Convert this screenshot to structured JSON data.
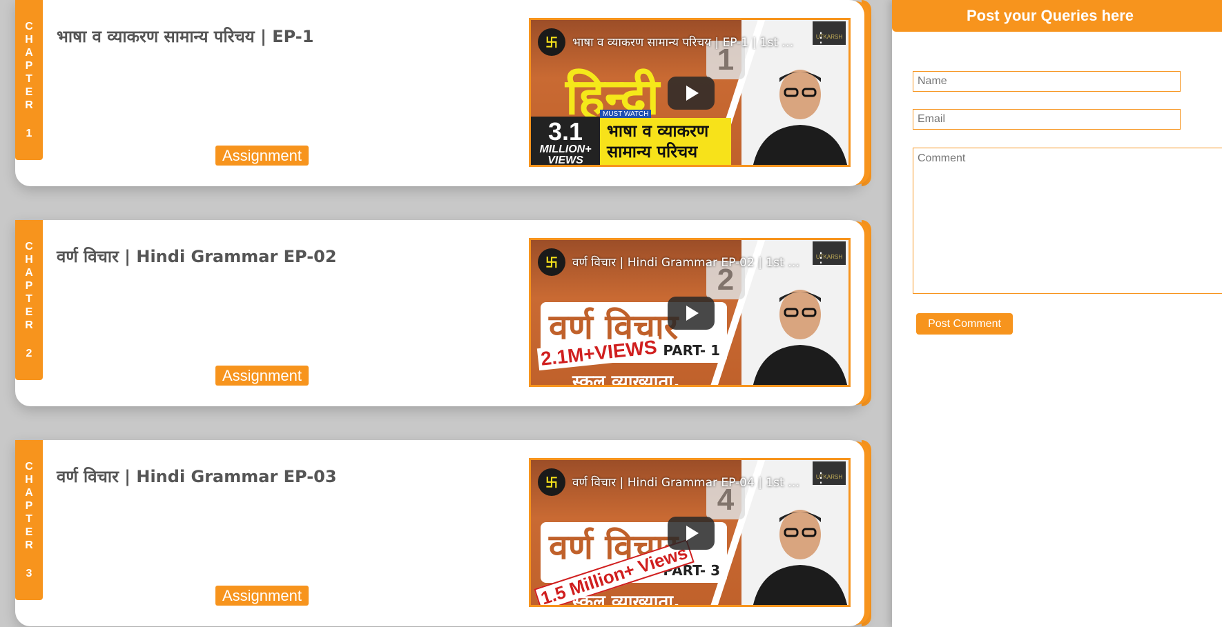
{
  "chapters": [
    {
      "tab_word": [
        "C",
        "H",
        "A",
        "P",
        "T",
        "E",
        "R"
      ],
      "number": "1",
      "title": "भाषा व व्याकरण सामान्य परिचय | EP-1",
      "assignment_label": "Assignment",
      "video": {
        "overlay_title": "भाषा व व्याकरण सामान्य परिचय | EP-1 | 1st G...",
        "badge_number": "1",
        "big_text": "हिन्दी",
        "must_watch": "MUST WATCH",
        "views_number": "3.1",
        "views_text": "MILLION+ VIEWS",
        "thumb_caption": "भाषा व व्याकरण सामान्य परिचय"
      }
    },
    {
      "tab_word": [
        "C",
        "H",
        "A",
        "P",
        "T",
        "E",
        "R"
      ],
      "number": "2",
      "title": "वर्ण विचार | Hindi Grammar EP-02",
      "assignment_label": "Assignment",
      "video": {
        "overlay_title": "वर्ण विचार | Hindi Grammar EP-02 | 1st Grd...",
        "badge_number": "2",
        "box_text": "वर्ण विचार",
        "part_text": "PART- 1",
        "views_sticker": "2.1M+VIEWS",
        "teacher_line": "स्कूल व्याख्याता,"
      }
    },
    {
      "tab_word": [
        "C",
        "H",
        "A",
        "P",
        "T",
        "E",
        "R"
      ],
      "number": "3",
      "title": "वर्ण विचार | Hindi Grammar EP-03",
      "assignment_label": "Assignment",
      "video": {
        "overlay_title": "वर्ण विचार | Hindi Grammar EP-04 | 1st Grd...",
        "badge_number": "4",
        "box_text": "वर्ण विचार",
        "part_text": "PART- 3",
        "views_sticker": "1.5 Million+ Views",
        "teacher_line": "स्कूल व्याख्याता,"
      }
    }
  ],
  "queries": {
    "title": "Post your Queries here",
    "name_placeholder": "Name",
    "email_placeholder": "Email",
    "comment_placeholder": "Comment",
    "post_button": "Post Comment"
  },
  "channel_logo_glyph": "卐",
  "brand_text": "UTKARSH",
  "colors": {
    "accent": "#f7941d",
    "background": "#c8c8c8",
    "title_text": "#555555"
  }
}
